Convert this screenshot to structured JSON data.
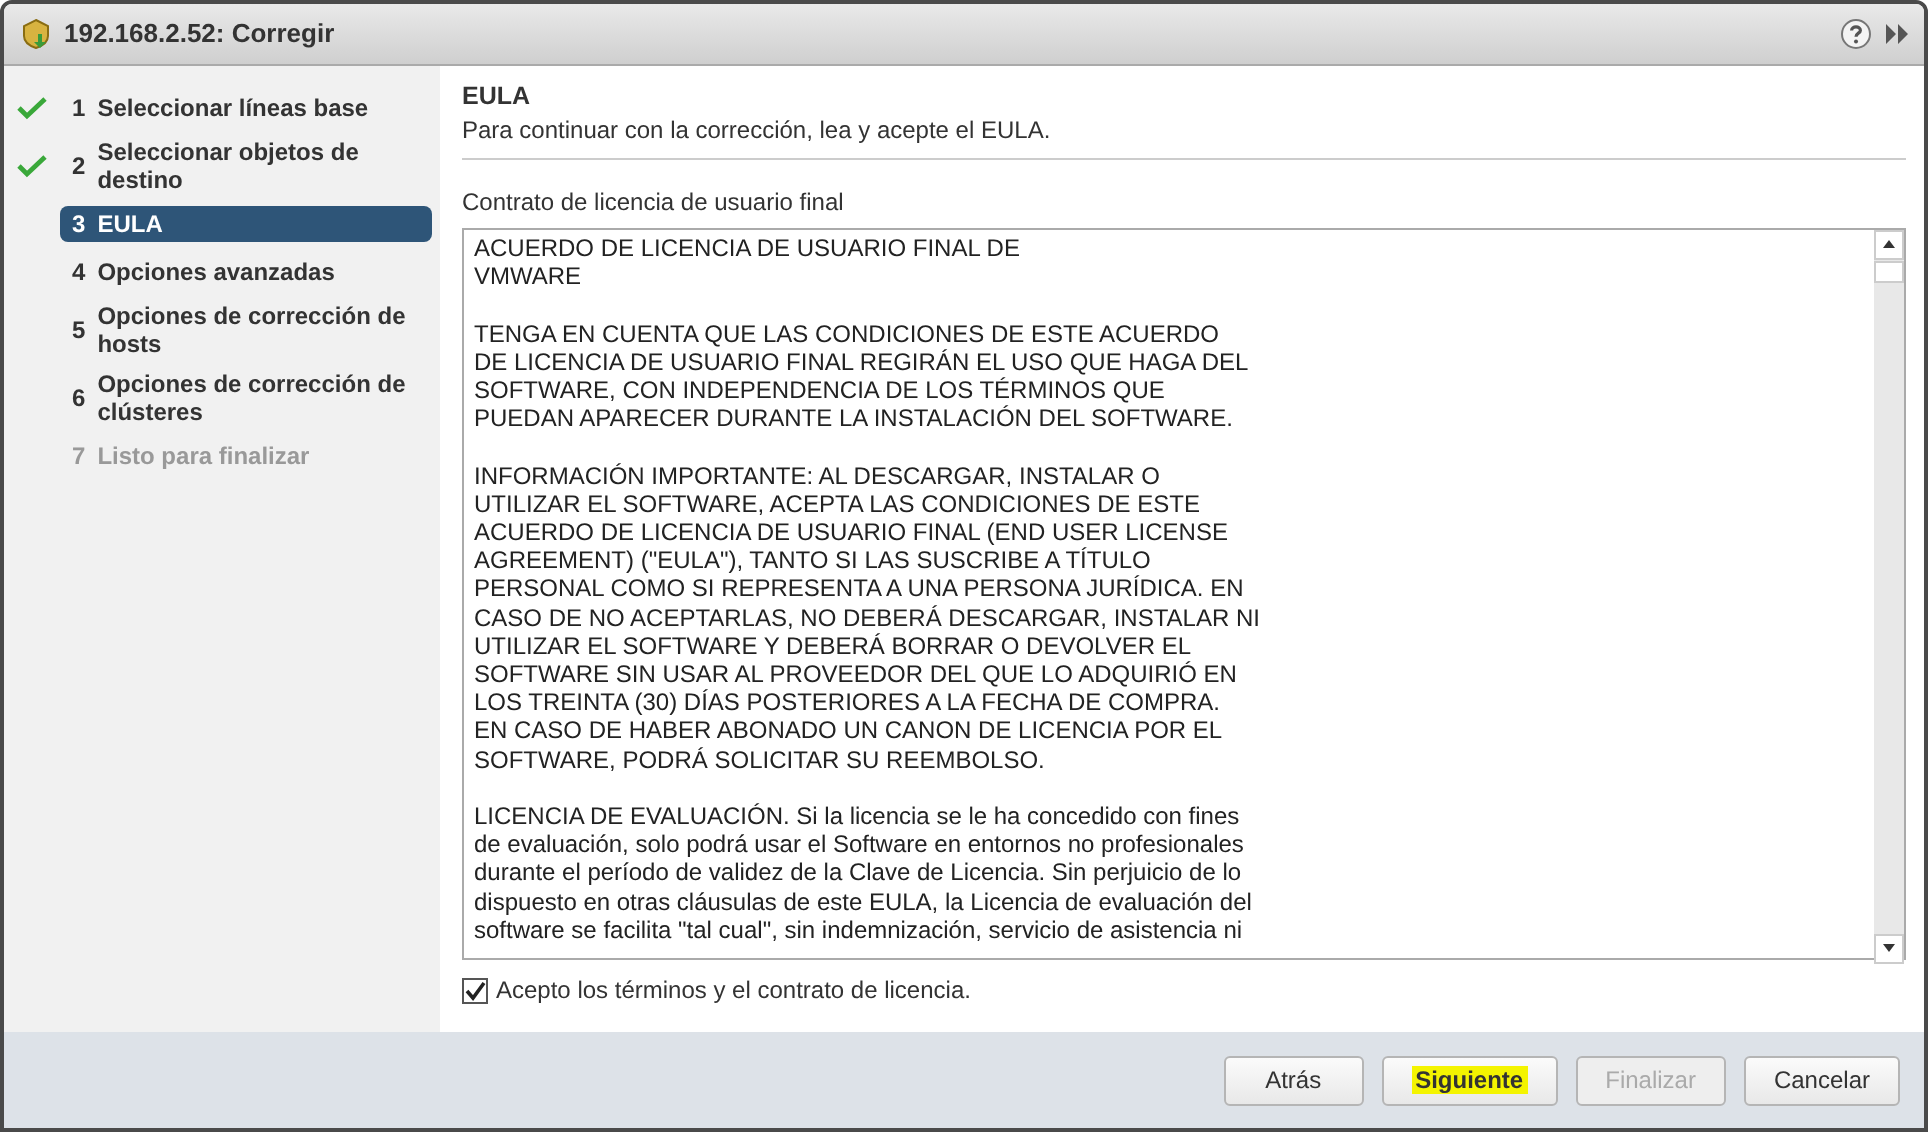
{
  "window": {
    "title": "192.168.2.52: Corregir"
  },
  "steps": [
    {
      "number": "1",
      "label": "Seleccionar líneas base",
      "completed": true,
      "selected": false,
      "disabled": false
    },
    {
      "number": "2",
      "label": "Seleccionar objetos de destino",
      "completed": true,
      "selected": false,
      "disabled": false
    },
    {
      "number": "3",
      "label": "EULA",
      "completed": false,
      "selected": true,
      "disabled": false
    },
    {
      "number": "4",
      "label": "Opciones avanzadas",
      "completed": false,
      "selected": false,
      "disabled": false
    },
    {
      "number": "5",
      "label": "Opciones de corrección de hosts",
      "completed": false,
      "selected": false,
      "disabled": false
    },
    {
      "number": "6",
      "label": "Opciones de corrección de clústeres",
      "completed": false,
      "selected": false,
      "disabled": false
    },
    {
      "number": "7",
      "label": "Listo para finalizar",
      "completed": false,
      "selected": false,
      "disabled": true
    }
  ],
  "page": {
    "title": "EULA",
    "subtitle": "Para continuar con la corrección, lea y acepte el EULA."
  },
  "eula": {
    "label": "Contrato de licencia de usuario final",
    "paragraphs": [
      [
        "ACUERDO DE LICENCIA DE USUARIO FINAL DE",
        "VMWARE"
      ],
      [
        "TENGA EN CUENTA QUE LAS CONDICIONES DE ESTE ACUERDO",
        "DE LICENCIA DE USUARIO FINAL REGIRÁN EL USO QUE HAGA DEL",
        "SOFTWARE, CON INDEPENDENCIA DE LOS TÉRMINOS QUE",
        "PUEDAN APARECER DURANTE LA INSTALACIÓN DEL SOFTWARE."
      ],
      [
        "INFORMACIÓN IMPORTANTE:  AL DESCARGAR, INSTALAR O",
        "UTILIZAR EL SOFTWARE, ACEPTA LAS CONDICIONES DE ESTE",
        "ACUERDO DE LICENCIA DE USUARIO FINAL (END USER LICENSE",
        "AGREEMENT) (\"EULA\"), TANTO SI LAS SUSCRIBE A TÍTULO",
        "PERSONAL COMO SI REPRESENTA A UNA PERSONA JURÍDICA. EN",
        "CASO DE NO ACEPTARLAS, NO DEBERÁ DESCARGAR, INSTALAR NI",
        "UTILIZAR EL SOFTWARE Y DEBERÁ BORRAR O DEVOLVER EL",
        "SOFTWARE SIN USAR AL PROVEEDOR DEL QUE LO ADQUIRIÓ EN",
        "LOS TREINTA (30) DÍAS POSTERIORES A LA FECHA DE COMPRA.",
        "EN CASO DE HABER ABONADO UN CANON DE LICENCIA POR EL",
        "SOFTWARE, PODRÁ SOLICITAR SU REEMBOLSO."
      ],
      [
        "LICENCIA DE EVALUACIÓN.  Si la licencia se le ha concedido con fines",
        "de evaluación, solo podrá usar el Software en entornos no profesionales",
        "durante el período de validez de la Clave de Licencia. Sin perjuicio de lo",
        "dispuesto en otras cláusulas de este EULA, la Licencia de evaluación del",
        "software se facilita \"tal cual\", sin indemnización, servicio de asistencia ni"
      ]
    ]
  },
  "accept": {
    "label": "Acepto los términos y el contrato de licencia.",
    "checked": true
  },
  "buttons": [
    {
      "label": "Atrás",
      "disabled": false,
      "highlighted": false
    },
    {
      "label": "Siguiente",
      "disabled": false,
      "highlighted": true
    },
    {
      "label": "Finalizar",
      "disabled": true,
      "highlighted": false
    },
    {
      "label": "Cancelar",
      "disabled": false,
      "highlighted": false
    }
  ]
}
